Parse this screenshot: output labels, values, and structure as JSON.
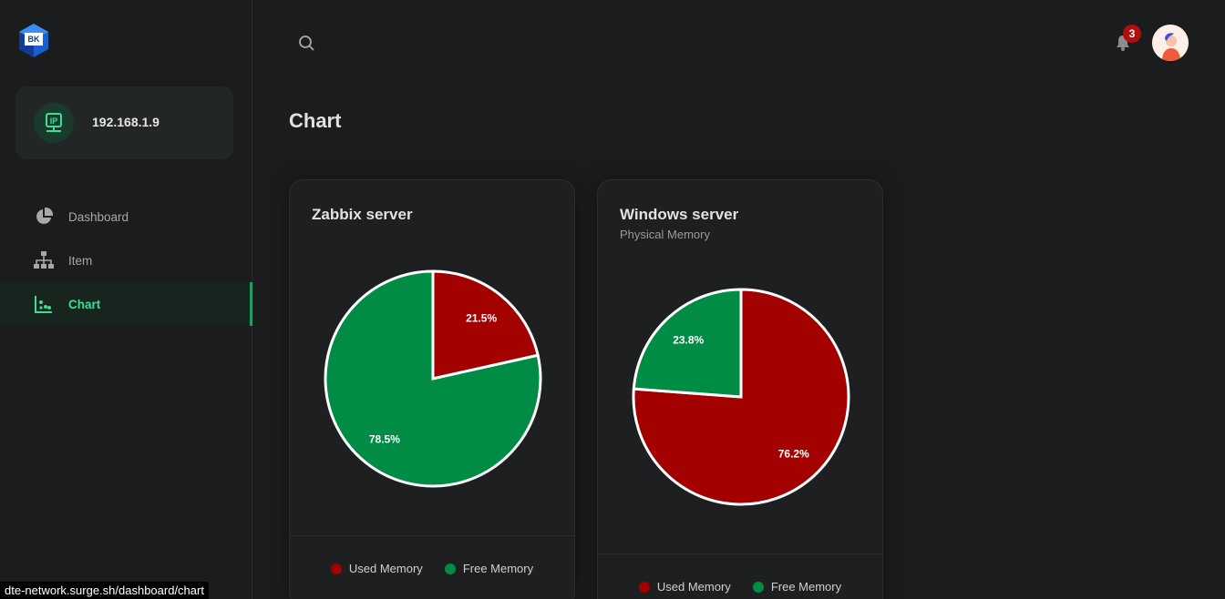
{
  "app": {
    "logo_text": "BK",
    "ip_address": "192.168.1.9",
    "page_title": "Chart",
    "notification_count": "3",
    "status_url": "dte-network.surge.sh/dashboard/chart"
  },
  "sidebar": {
    "items": [
      {
        "label": "Dashboard",
        "icon": "pie-chart-icon",
        "active": false
      },
      {
        "label": "Item",
        "icon": "sitemap-icon",
        "active": false
      },
      {
        "label": "Chart",
        "icon": "scatter-chart-icon",
        "active": true
      }
    ]
  },
  "colors": {
    "used": "#a30000",
    "free": "#008c45",
    "accent": "#3ddc97"
  },
  "cards": [
    {
      "title": "Zabbix server",
      "subtitle": "",
      "legend": [
        "Used Memory",
        "Free Memory"
      ]
    },
    {
      "title": "Windows server",
      "subtitle": "Physical Memory",
      "legend": [
        "Used Memory",
        "Free Memory"
      ]
    }
  ],
  "chart_data": [
    {
      "type": "pie",
      "title": "Zabbix server",
      "categories": [
        "Used Memory",
        "Free Memory"
      ],
      "values": [
        21.5,
        78.5
      ],
      "labels": [
        "21.5%",
        "78.5%"
      ],
      "legend_position": "bottom"
    },
    {
      "type": "pie",
      "title": "Windows server",
      "subtitle": "Physical Memory",
      "categories": [
        "Used Memory",
        "Free Memory"
      ],
      "values": [
        76.2,
        23.8
      ],
      "labels": [
        "76.2%",
        "23.8%"
      ],
      "legend_position": "bottom"
    }
  ]
}
